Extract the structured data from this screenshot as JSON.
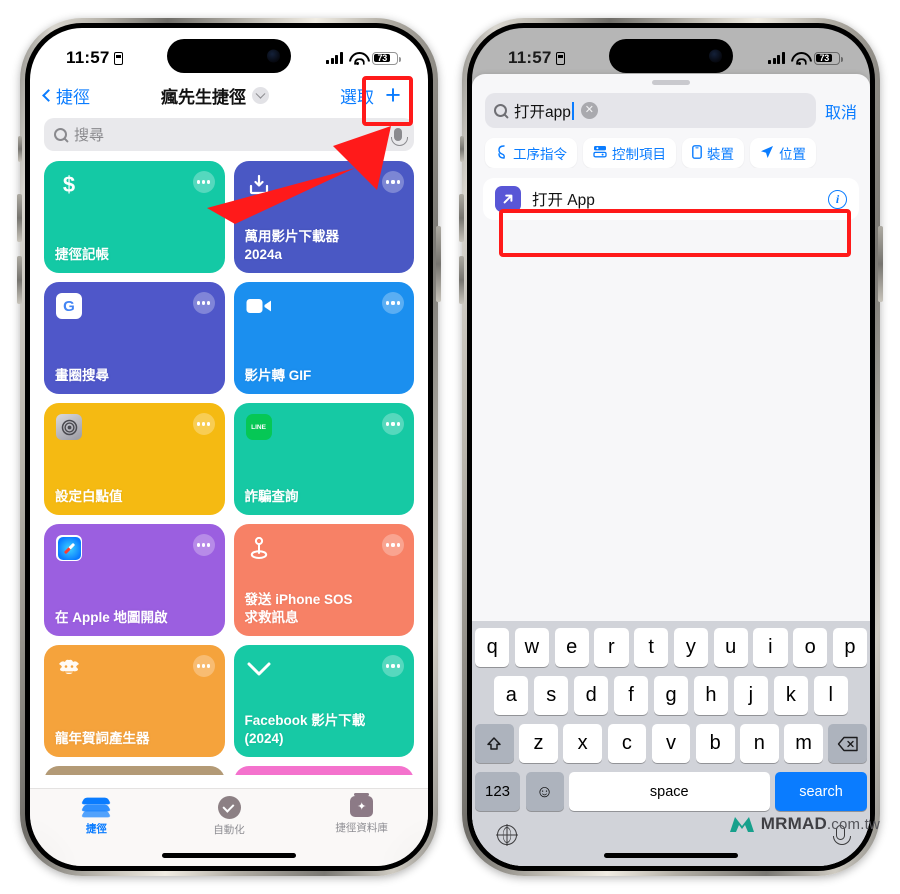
{
  "status_bar": {
    "time": "11:57",
    "battery": "73",
    "lock_icon": "lock-icon",
    "wifi_icon": "wifi-icon",
    "cellular_icon": "cellular-bars-icon"
  },
  "left_phone": {
    "nav": {
      "back_label": "捷徑",
      "title": "瘋先生捷徑",
      "select_label": "選取",
      "add_label": "+"
    },
    "search": {
      "placeholder": "搜尋"
    },
    "shortcuts": [
      {
        "name": "捷徑記帳",
        "color": "#14c9a5",
        "icon": "dollar-sign-icon",
        "glyph": "$"
      },
      {
        "name": "萬用影片下載器\n2024a",
        "color": "#4a58c4",
        "icon": "download-box-icon",
        "glyph": ""
      },
      {
        "name": "畫圈搜尋",
        "color": "#4f57c9",
        "icon": "google-logo-icon",
        "glyph": "G"
      },
      {
        "name": "影片轉 GIF",
        "color": "#1b8fef",
        "icon": "video-camera-icon",
        "glyph": ""
      },
      {
        "name": "設定白點值",
        "color": "#f5ba12",
        "icon": "settings-accessibility-icon",
        "glyph": ""
      },
      {
        "name": "詐騙查詢",
        "color": "#16c9a4",
        "icon": "line-app-icon",
        "glyph": "LINE"
      },
      {
        "name": "在 Apple 地圖開啟",
        "color": "#9b5fe0",
        "icon": "safari-compass-icon",
        "glyph": ""
      },
      {
        "name": "發送 iPhone SOS\n求救訊息",
        "color": "#f78166",
        "icon": "location-pin-icon",
        "glyph": ""
      },
      {
        "name": "龍年賀詞產生器",
        "color": "#f5a33c",
        "icon": "dragon-icon",
        "glyph": ""
      },
      {
        "name": "Facebook 影片下載\n(2024)",
        "color": "#17c9a5",
        "icon": "chevron-down-icon",
        "glyph": ""
      },
      {
        "name": "",
        "color": "#b39a76",
        "icon": "safari-compass-icon",
        "glyph": ""
      },
      {
        "name": "",
        "color": "#f472cd",
        "icon": "camera-scan-icon",
        "glyph": ""
      }
    ],
    "tabs": [
      {
        "label": "捷徑",
        "icon": "shortcuts-stack-icon",
        "active": true
      },
      {
        "label": "自動化",
        "icon": "automation-clock-icon",
        "active": false
      },
      {
        "label": "捷徑資料庫",
        "icon": "shortcuts-gallery-icon",
        "active": false
      }
    ]
  },
  "right_phone": {
    "search": {
      "value": "打开app",
      "cancel_label": "取消",
      "clear_icon": "clear-circle-icon",
      "search_icon": "search-icon"
    },
    "filter_chips": [
      {
        "label": "工序指令",
        "icon": "script-icon"
      },
      {
        "label": "控制項目",
        "icon": "controls-icon"
      },
      {
        "label": "裝置",
        "icon": "device-icon"
      },
      {
        "label": "位置",
        "icon": "location-arrow-icon"
      }
    ],
    "result": {
      "label": "打开 App",
      "icon": "open-app-arrow-icon",
      "info_icon": "info-icon"
    },
    "keyboard": {
      "row1": [
        "q",
        "w",
        "e",
        "r",
        "t",
        "y",
        "u",
        "i",
        "o",
        "p"
      ],
      "row2": [
        "a",
        "s",
        "d",
        "f",
        "g",
        "h",
        "j",
        "k",
        "l"
      ],
      "row3": [
        "z",
        "x",
        "c",
        "v",
        "b",
        "n",
        "m"
      ],
      "shift_icon": "shift-arrow-icon",
      "backspace_icon": "backspace-icon",
      "numbers_label": "123",
      "emoji_icon": "emoji-smiley-icon",
      "space_label": "space",
      "return_label": "search",
      "globe_icon": "globe-icon",
      "dictation_icon": "microphone-icon"
    }
  },
  "watermark": {
    "brand": "MRMAD",
    "suffix": ".com.tw",
    "logo_icon": "mrmad-logo-icon",
    "color": "#17a08c"
  },
  "annotations": {
    "highlight_color": "#ff1a1a",
    "arrow_icon": "red-arrow-icon"
  }
}
